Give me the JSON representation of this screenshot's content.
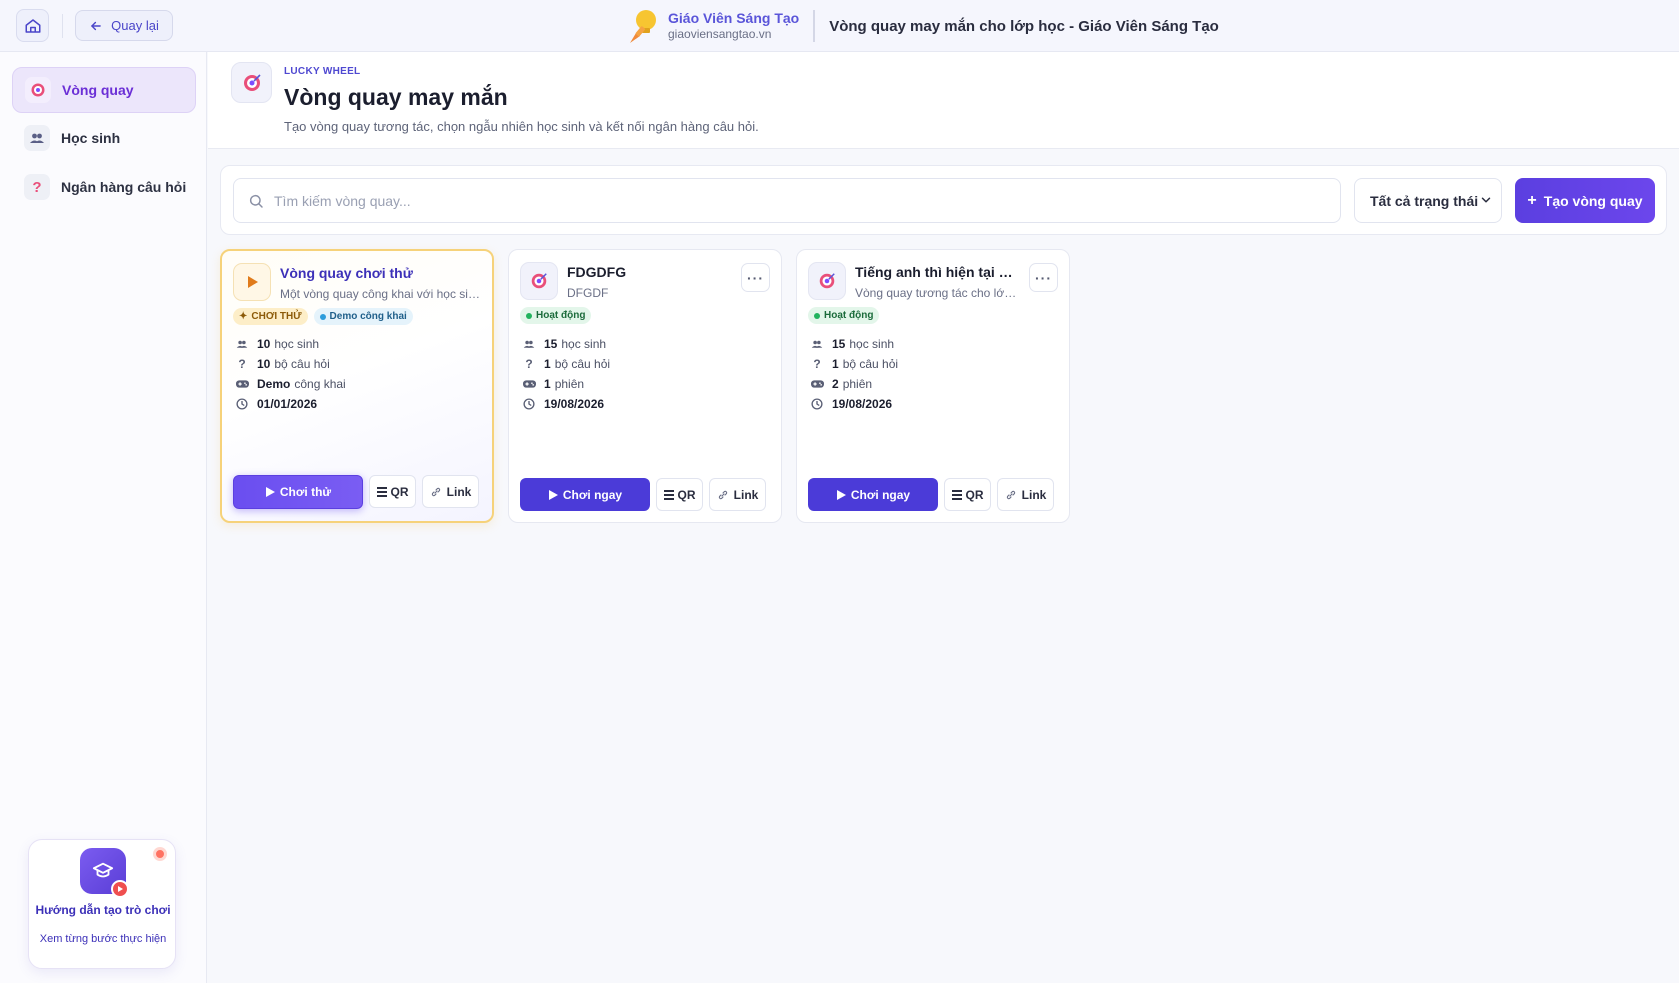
{
  "topbar": {
    "back_label": "Quay lại",
    "brand_name": "Giáo Viên Sáng Tạo",
    "brand_url": "giaoviensangtao.vn",
    "page_title": "Vòng quay may mắn cho lớp học - Giáo Viên Sáng Tạo"
  },
  "sidebar": {
    "items": [
      {
        "label": "Vòng quay",
        "icon": "target-icon",
        "active": true
      },
      {
        "label": "Học sinh",
        "icon": "users-icon",
        "active": false
      },
      {
        "label": "Ngân hàng câu hỏi",
        "icon": "question-icon",
        "active": false
      }
    ],
    "guide": {
      "title": "Hướng dẫn tạo trò chơi",
      "subtitle": "Xem từng bước thực hiện"
    }
  },
  "header": {
    "eyebrow": "LUCKY WHEEL",
    "title": "Vòng quay may mắn",
    "subtitle": "Tạo vòng quay tương tác, chọn ngẫu nhiên học sinh và kết nối ngân hàng câu hỏi."
  },
  "toolbar": {
    "search_placeholder": "Tìm kiếm vòng quay...",
    "status_filter": "Tất cả trạng thái",
    "create_label": "Tạo vòng quay"
  },
  "cards": [
    {
      "title": "Vòng quay chơi thử",
      "description": "Một vòng quay công khai với học sinh mẫu",
      "badges": [
        {
          "label": "CHƠI THỬ",
          "kind": "trial"
        },
        {
          "label": "Demo công khai",
          "kind": "public"
        }
      ],
      "stats": [
        {
          "value": "10",
          "label": "học sinh",
          "icon": "users-icon"
        },
        {
          "value": "10",
          "label": "bộ câu hỏi",
          "icon": "question-icon"
        },
        {
          "value": "Demo",
          "label": "công khai",
          "icon": "gamepad-icon"
        },
        {
          "value": "01/01/2026",
          "label": "",
          "icon": "clock-icon"
        }
      ],
      "play_label": "Chơi thử",
      "qr_label": "QR",
      "link_label": "Link"
    },
    {
      "title": "FDGDFG",
      "description": "DFGDF",
      "badges": [
        {
          "label": "Hoạt động",
          "kind": "active"
        }
      ],
      "stats": [
        {
          "value": "15",
          "label": "học sinh",
          "icon": "users-icon"
        },
        {
          "value": "1",
          "label": "bộ câu hỏi",
          "icon": "question-icon"
        },
        {
          "value": "1",
          "label": "phiên",
          "icon": "gamepad-icon"
        },
        {
          "value": "19/08/2026",
          "label": "",
          "icon": "clock-icon"
        }
      ],
      "play_label": "Chơi ngay",
      "qr_label": "QR",
      "link_label": "Link"
    },
    {
      "title": "Tiếng anh thì hiện tại đơn",
      "description": "Vòng quay tương tác cho lớp học",
      "badges": [
        {
          "label": "Hoạt động",
          "kind": "active"
        }
      ],
      "stats": [
        {
          "value": "15",
          "label": "học sinh",
          "icon": "users-icon"
        },
        {
          "value": "1",
          "label": "bộ câu hỏi",
          "icon": "question-icon"
        },
        {
          "value": "2",
          "label": "phiên",
          "icon": "gamepad-icon"
        },
        {
          "value": "19/08/2026",
          "label": "",
          "icon": "clock-icon"
        }
      ],
      "play_label": "Chơi ngay",
      "qr_label": "QR",
      "link_label": "Link"
    }
  ],
  "colors": {
    "accent": "#5b3fe0",
    "active_nav_bg": "#ece6fb",
    "demo_border": "#f6d27a"
  }
}
